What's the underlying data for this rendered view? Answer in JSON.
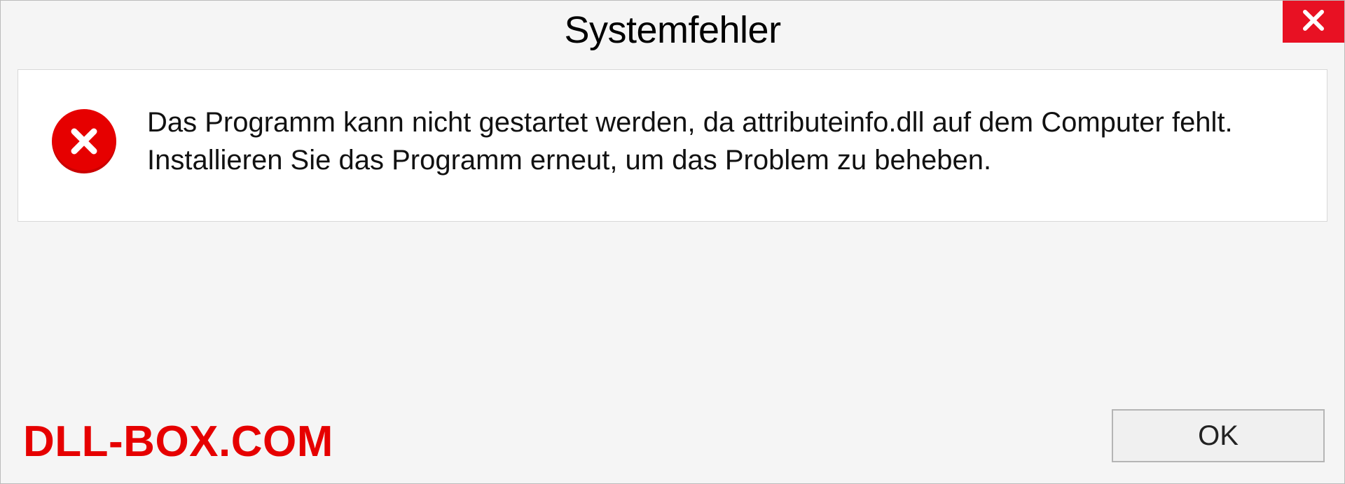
{
  "title": "Systemfehler",
  "message": "Das Programm kann nicht gestartet werden, da attributeinfo.dll auf dem Computer fehlt. Installieren Sie das Programm erneut, um das Problem zu beheben.",
  "watermark": "DLL-BOX.COM",
  "buttons": {
    "ok": "OK"
  },
  "icons": {
    "close": "close-icon",
    "error": "error-icon"
  }
}
